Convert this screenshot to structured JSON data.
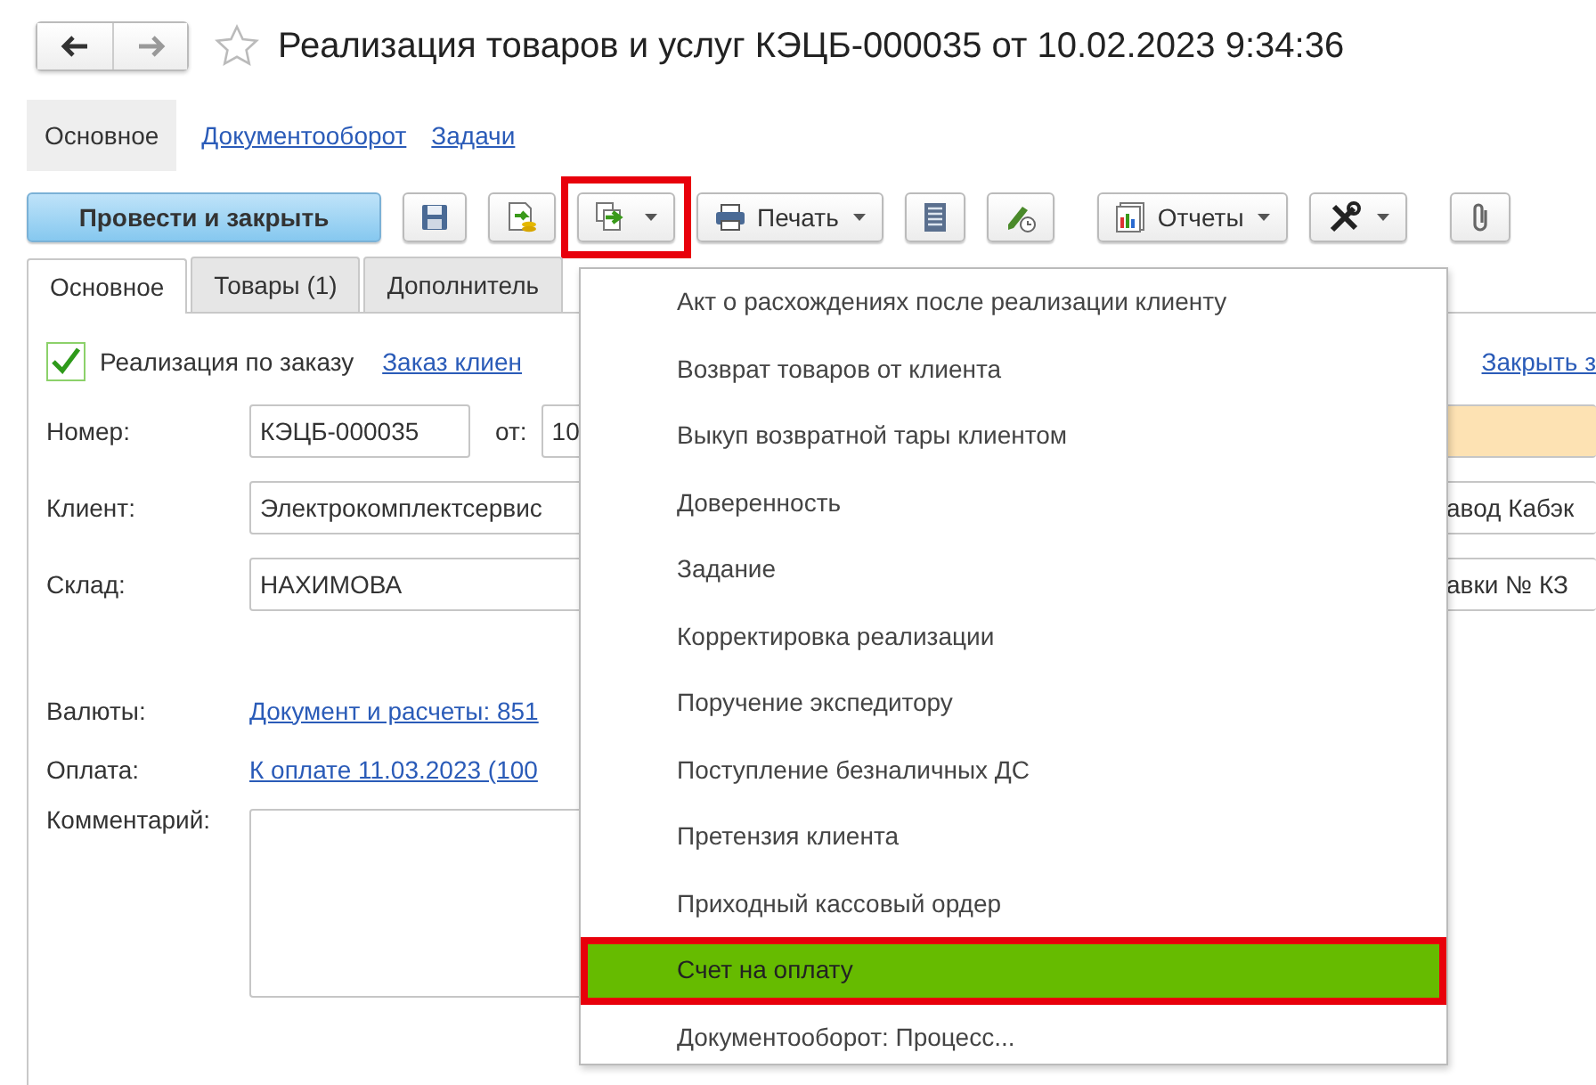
{
  "window": {
    "title": "Реализация товаров и услуг КЭЦБ-000035 от 10.02.2023 9:34:36",
    "favorite": false
  },
  "nav_tabs": [
    {
      "label": "Основное",
      "selected": true
    },
    {
      "label": "Документооборот",
      "selected": false
    },
    {
      "label": "Задачи",
      "selected": false
    }
  ],
  "toolbar": [
    {
      "kind": "primary",
      "label": "Провести и закрыть",
      "highlighted": false
    },
    {
      "kind": "icon",
      "highlighted": false
    },
    {
      "kind": "icon",
      "highlighted": false
    },
    {
      "kind": "icon-dropdown",
      "highlighted": true
    },
    {
      "kind": "labeled-dropdown",
      "label": "Печать",
      "highlighted": false
    },
    {
      "kind": "icon",
      "highlighted": false
    },
    {
      "kind": "icon",
      "highlighted": false
    },
    {
      "kind": "labeled-dropdown",
      "label": "Отчеты",
      "highlighted": false
    },
    {
      "kind": "icon-dropdown",
      "highlighted": false
    },
    {
      "kind": "icon",
      "highlighted": false
    }
  ],
  "form_tabs": [
    {
      "label": "Основное",
      "selected": true
    },
    {
      "label": "Товары (1)",
      "selected": false
    },
    {
      "label": "Дополнитель",
      "selected": false
    }
  ],
  "by_order": {
    "label": "Реализация по заказу",
    "checked": true,
    "link": "Заказ клиен",
    "close_link": "Закрыть з"
  },
  "number": {
    "label": "Номер:",
    "value": "КЭЦБ-000035",
    "date_label": "от:",
    "date_value": "10"
  },
  "client": {
    "label": "Клиент:",
    "value": "Электрокомплектсервис",
    "contract_value": "авод Кабэк"
  },
  "warehouse": {
    "label": "Склад:",
    "value": "НАХИМОВА",
    "delivery_value": "авки № КЗ"
  },
  "currency": {
    "label": "Валюты:",
    "link": "Документ и расчеты: 851"
  },
  "payment": {
    "label": "Оплата:",
    "link": "К оплате 11.03.2023 (100"
  },
  "comment": {
    "label": "Комментарий:"
  },
  "menu": [
    {
      "label": "Акт о расхождениях после реализации клиенту",
      "selected": false
    },
    {
      "label": "Возврат товаров от клиента",
      "selected": false
    },
    {
      "label": "Выкуп возвратной тары клиентом",
      "selected": false
    },
    {
      "label": "Доверенность",
      "selected": false
    },
    {
      "label": "Задание",
      "selected": false
    },
    {
      "label": "Корректировка реализации",
      "selected": false
    },
    {
      "label": "Поручение экспедитору",
      "selected": false
    },
    {
      "label": "Поступление безналичных ДС",
      "selected": false
    },
    {
      "label": "Претензия клиента",
      "selected": false
    },
    {
      "label": "Приходный кассовый ордер",
      "selected": false
    },
    {
      "label": "Счет на оплату",
      "selected": true
    },
    {
      "label": "Документооборот: Процесс...",
      "selected": false
    }
  ]
}
